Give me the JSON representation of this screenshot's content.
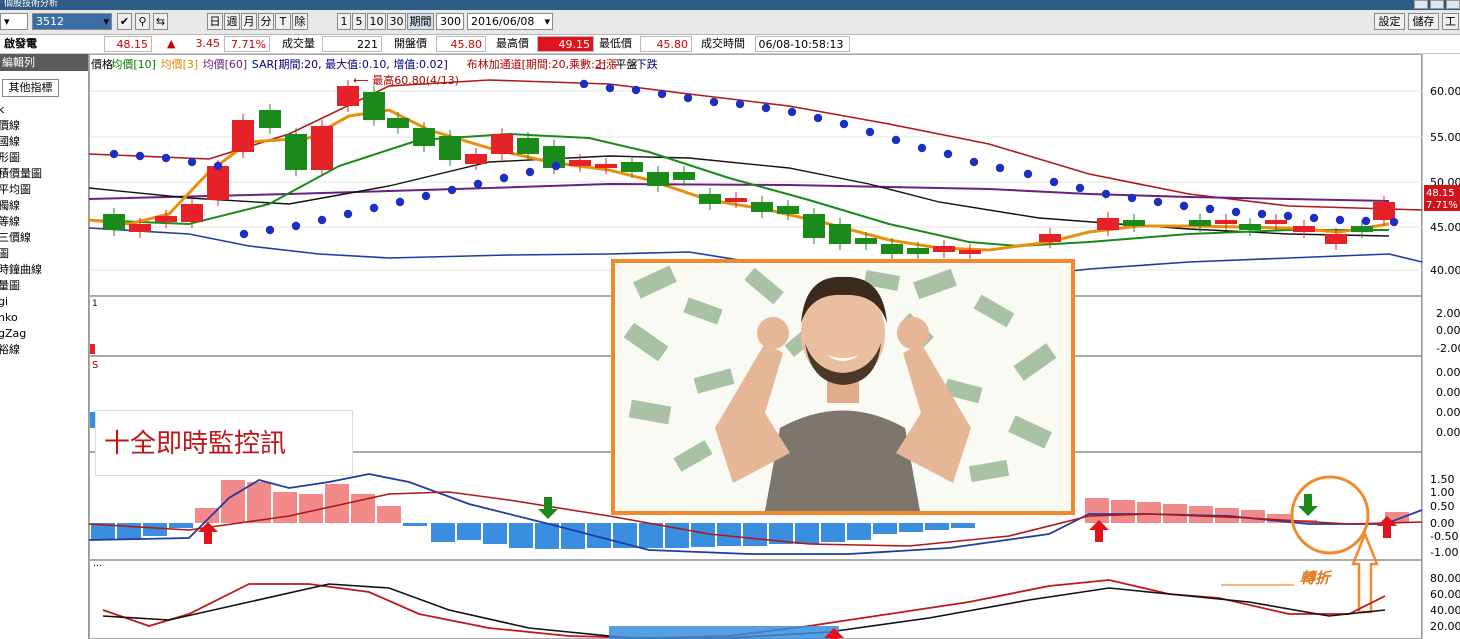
{
  "window": {
    "title": "個股技術分析"
  },
  "toolbar": {
    "stock_code": "3512",
    "period_buttons": [
      "日",
      "週",
      "月",
      "分",
      "T",
      "除"
    ],
    "minute_buttons": [
      "1",
      "5",
      "10",
      "30"
    ],
    "period_label": "期間",
    "period_value": "300",
    "date_value": "2016/06/08",
    "right_buttons": [
      "設定",
      "儲存",
      "工"
    ]
  },
  "quote": {
    "name": "啟發電",
    "price": "48.15",
    "change": "3.45",
    "change_pct": "7.71%",
    "volume_label": "成交量",
    "volume": "221",
    "open_label": "開盤價",
    "open": "45.80",
    "high_label": "最高價",
    "high": "49.15",
    "low_label": "最低價",
    "low": "45.80",
    "time_label": "成交時間",
    "time": "06/08-10:58:13"
  },
  "sidebar": {
    "header": "編輯列",
    "tab": "其他指標",
    "items": [
      "k",
      "價線",
      "國線",
      "形圖",
      "積價量圖",
      "平均圖",
      "獨線",
      "等線",
      "三價線",
      "圖",
      "時鐘曲線",
      "量圖",
      "gi",
      "nko",
      "gZag",
      "裕線"
    ]
  },
  "legend": {
    "items": [
      "價格",
      "均價[10]",
      "均價[3]",
      "均價[60]",
      "SAR[期間:20, 最大值:0.10, 增值:0.02]",
      "布林加通道[期間:20,乘數:2]",
      "上漲",
      "平盤",
      "下跌"
    ],
    "colors": [
      "#000000",
      "#008000",
      "#e08a00",
      "#6a2080",
      "#000080",
      "#b00000",
      "#b00000",
      "#000000",
      "#000080"
    ]
  },
  "annotations": {
    "max_label": "最高60.80(4/13)",
    "price_tag": "48.15",
    "price_tag_pct": "7.71%",
    "overlay_text": "十全即時監控訊",
    "turn_label": "轉折"
  },
  "axes": {
    "price_ticks": [
      "60.00",
      "55.00",
      "50.00",
      "45.00",
      "40.00"
    ],
    "panel2_ticks": [
      "2.00",
      "0.00",
      "-2.00"
    ],
    "panel3_ticks": [
      "0.00",
      "0.00",
      "0.00",
      "0.00"
    ],
    "macd_ticks": [
      "1.50",
      "1.00",
      "0.50",
      "0.00",
      "-0.50",
      "-1.00"
    ],
    "kd_ticks": [
      "80.00",
      "60.00",
      "40.00",
      "20.00"
    ]
  },
  "colors": {
    "up": "#e52228",
    "down": "#1a8a1a",
    "sar": "#1c2fbf",
    "macd_pos": "#f28a8a",
    "macd_neg": "#3a8ee0",
    "accent": "#f08a2c"
  }
}
